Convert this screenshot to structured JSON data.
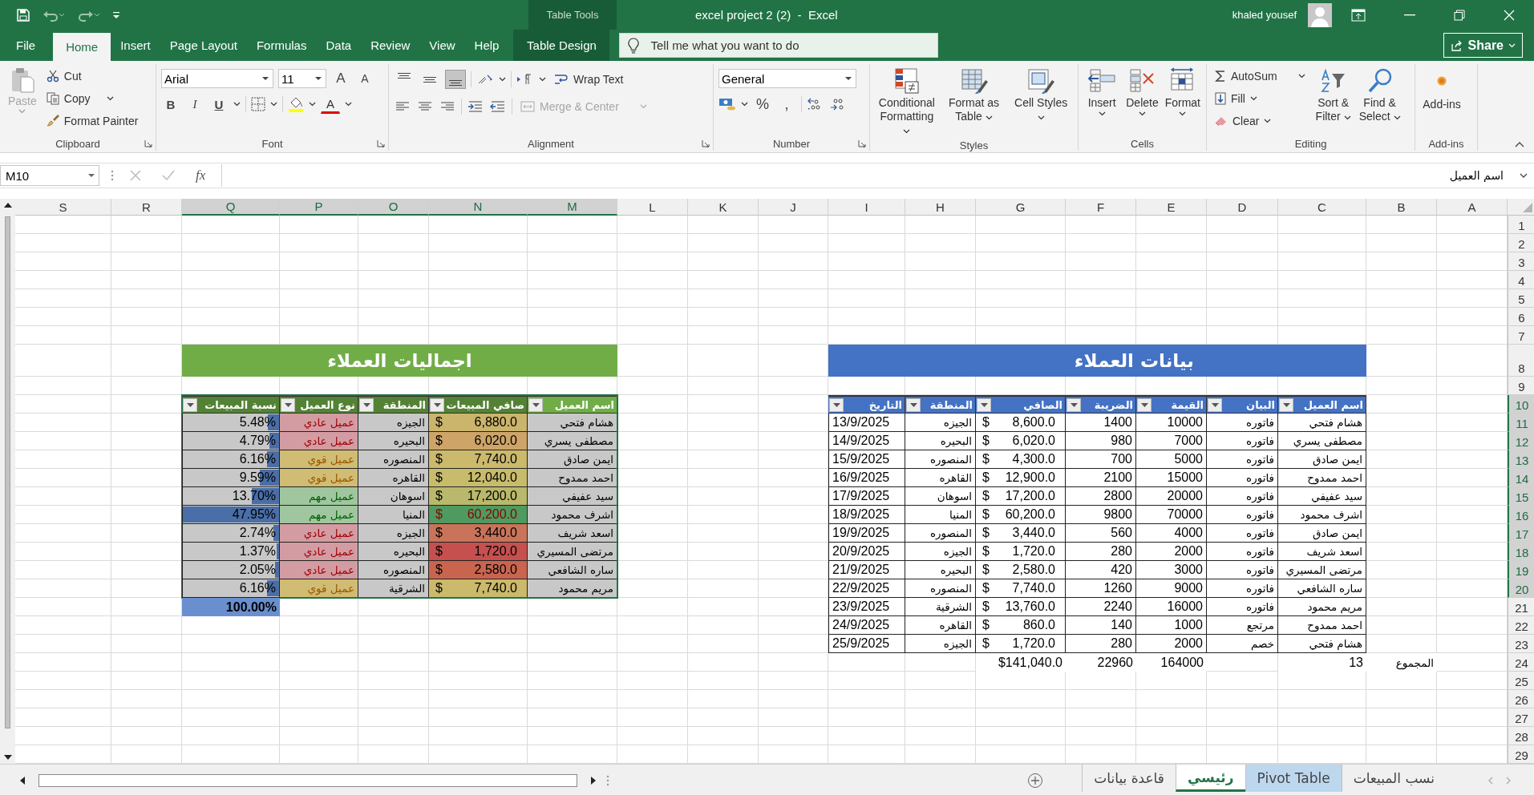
{
  "window": {
    "context_label": "Table Tools",
    "title": "excel project 2 (2)  -  Excel",
    "user": "khaled yousef"
  },
  "tabs": [
    {
      "label": "Table Design",
      "selected": false,
      "kind": "contextual"
    },
    {
      "label": "Help",
      "selected": false,
      "kind": "standard"
    },
    {
      "label": "View",
      "selected": false,
      "kind": "standard"
    },
    {
      "label": "Review",
      "selected": false,
      "kind": "standard"
    },
    {
      "label": "Data",
      "selected": false,
      "kind": "standard"
    },
    {
      "label": "Formulas",
      "selected": false,
      "kind": "standard"
    },
    {
      "label": "Page Layout",
      "selected": false,
      "kind": "standard"
    },
    {
      "label": "Insert",
      "selected": false,
      "kind": "standard"
    },
    {
      "label": "Home",
      "selected": true,
      "kind": "standard"
    },
    {
      "label": "File",
      "selected": false,
      "kind": "standard"
    }
  ],
  "tell_me": {
    "placeholder": "Tell me what you want to do"
  },
  "share": {
    "label": "Share"
  },
  "ribbon": {
    "clipboard": {
      "label": "Clipboard",
      "paste": {
        "label": "Paste",
        "disabled": true
      },
      "cut": "Cut",
      "copy": "Copy",
      "format_painter": "Format Painter"
    },
    "font": {
      "label": "Font",
      "name": "Arial",
      "size": "11",
      "grow": "A",
      "shrink": "A",
      "bold": "B",
      "italic": "I",
      "underline": "U",
      "color_letter": "A"
    },
    "alignment": {
      "label": "Alignment",
      "vertical": [
        {
          "selected": false
        },
        {
          "selected": false
        },
        {
          "selected": true
        }
      ],
      "wrap_text": "Wrap Text",
      "merge": {
        "label": "Merge & Center",
        "disabled": true
      }
    },
    "number": {
      "label": "Number",
      "format": "General",
      "percent": "%",
      "comma": ","
    },
    "styles": {
      "label": "Styles",
      "buttons": [
        "Cell Styles",
        "Format as Table",
        "Conditional Formatting"
      ]
    },
    "cells": {
      "label": "Cells",
      "buttons": [
        "Format",
        "Delete",
        "Insert"
      ]
    },
    "editing": {
      "label": "Editing",
      "autosum": "AutoSum",
      "fill": "Fill",
      "clear": "Clear",
      "sort": "Sort & Filter",
      "find": "Find & Select"
    },
    "addins": {
      "label": "Add-ins",
      "button": "Add-ins"
    }
  },
  "formula_bar": {
    "name_box": "M10",
    "fx": "fx",
    "value": "اسم العميل"
  },
  "sheet": {
    "column_headers": [
      {
        "label": "A",
        "selected": false
      },
      {
        "label": "B",
        "selected": false
      },
      {
        "label": "C",
        "selected": false
      },
      {
        "label": "D",
        "selected": false
      },
      {
        "label": "E",
        "selected": false
      },
      {
        "label": "F",
        "selected": false
      },
      {
        "label": "G",
        "selected": false
      },
      {
        "label": "H",
        "selected": false
      },
      {
        "label": "I",
        "selected": false
      },
      {
        "label": "J",
        "selected": false
      },
      {
        "label": "K",
        "selected": false
      },
      {
        "label": "L",
        "selected": false
      },
      {
        "label": "M",
        "selected": true
      },
      {
        "label": "N",
        "selected": true
      },
      {
        "label": "O",
        "selected": true
      },
      {
        "label": "P",
        "selected": true
      },
      {
        "label": "Q",
        "selected": true
      },
      {
        "label": "R",
        "selected": false
      },
      {
        "label": "S",
        "selected": false
      }
    ],
    "row_headers": [
      {
        "label": "1",
        "selected": false
      },
      {
        "label": "2",
        "selected": false
      },
      {
        "label": "3",
        "selected": false
      },
      {
        "label": "4",
        "selected": false
      },
      {
        "label": "5",
        "selected": false
      },
      {
        "label": "6",
        "selected": false
      },
      {
        "label": "7",
        "selected": false
      },
      {
        "label": "8",
        "selected": false
      },
      {
        "label": "9",
        "selected": false
      },
      {
        "label": "10",
        "selected": true
      },
      {
        "label": "11",
        "selected": true
      },
      {
        "label": "12",
        "selected": true
      },
      {
        "label": "13",
        "selected": true
      },
      {
        "label": "14",
        "selected": true
      },
      {
        "label": "15",
        "selected": true
      },
      {
        "label": "16",
        "selected": true
      },
      {
        "label": "17",
        "selected": true
      },
      {
        "label": "18",
        "selected": true
      },
      {
        "label": "19",
        "selected": true
      },
      {
        "label": "20",
        "selected": true
      },
      {
        "label": "21",
        "selected": false
      },
      {
        "label": "22",
        "selected": false
      },
      {
        "label": "23",
        "selected": false
      },
      {
        "label": "24",
        "selected": false
      },
      {
        "label": "25",
        "selected": false
      },
      {
        "label": "26",
        "selected": false
      },
      {
        "label": "27",
        "selected": false
      },
      {
        "label": "28",
        "selected": false
      },
      {
        "label": "29",
        "selected": false
      }
    ]
  },
  "summary_table": {
    "title": "اجماليات العملاء",
    "selected": true,
    "columns": [
      "اسم العميل",
      "صافي المبيعات",
      "المنطقة",
      "نوع العميل",
      "نسبة المبيعات"
    ],
    "rows": [
      {
        "name": "هشام فتحي",
        "currency": "$",
        "net": "6,880.0",
        "color": "#cbb46b",
        "alert": false,
        "region": "الجيزه",
        "type": "عميل عادي",
        "kind": "regular",
        "share": "5.48%",
        "level": 0.114
      },
      {
        "name": "مصطفى يسري",
        "currency": "$",
        "net": "6,020.0",
        "color": "#cea468",
        "alert": false,
        "region": "البحيره",
        "type": "عميل عادي",
        "kind": "regular",
        "share": "4.79%",
        "level": 0.1
      },
      {
        "name": "ايمن صادق",
        "currency": "$",
        "net": "7,740.0",
        "color": "#cbb96c",
        "alert": false,
        "region": "المنصوره",
        "type": "عميل قوي",
        "kind": "strong",
        "share": "6.16%",
        "level": 0.128
      },
      {
        "name": "احمد ممدوح",
        "currency": "$",
        "net": "12,040.0",
        "color": "#c8bc6c",
        "alert": false,
        "region": "القاهره",
        "type": "عميل قوي",
        "kind": "strong",
        "share": "9.59%",
        "level": 0.2
      },
      {
        "name": "سيد عفيفي",
        "currency": "$",
        "net": "17,200.0",
        "color": "#b9b86c",
        "alert": false,
        "region": "اسوهان",
        "type": "عميل مهم",
        "kind": "important",
        "share": "13.70%",
        "level": 0.286
      },
      {
        "name": "اشرف محمود",
        "currency": "$",
        "net": "60,200.0",
        "color": "#4f9a60",
        "alert": true,
        "region": "المنيا",
        "type": "عميل مهم",
        "kind": "important",
        "share": "47.95%",
        "level": 1
      },
      {
        "name": "اسعد شريف",
        "currency": "$",
        "net": "3,440.0",
        "color": "#c9745a",
        "alert": false,
        "region": "الجيزه",
        "type": "عميل عادي",
        "kind": "regular",
        "share": "2.74%",
        "level": 0.057
      },
      {
        "name": "مرتضى المسيري",
        "currency": "$",
        "net": "1,720.0",
        "color": "#c5504e",
        "alert": false,
        "region": "البحيره",
        "type": "عميل عادي",
        "kind": "regular",
        "share": "1.37%",
        "level": 0.029
      },
      {
        "name": "ساره الشافعي",
        "currency": "$",
        "net": "2,580.0",
        "color": "#c9654f",
        "alert": false,
        "region": "المنصوره",
        "type": "عميل عادي",
        "kind": "regular",
        "share": "2.05%",
        "level": 0.043
      },
      {
        "name": "مريم محمود",
        "currency": "$",
        "net": "7,740.0",
        "color": "#cbb96c",
        "alert": false,
        "region": "الشرقية",
        "type": "عميل قوي",
        "kind": "strong",
        "share": "6.16%",
        "level": 0.128
      }
    ],
    "total": "100.00%"
  },
  "data_table": {
    "title": "بيانات العملاء",
    "columns": [
      "اسم العميل",
      "البيان",
      "القيمة",
      "الضريبة",
      "الصافي",
      "المنطقة",
      "التاريخ"
    ],
    "rows": [
      {
        "name": "هشام فتحي",
        "statement": "فاتوره",
        "value": "10000",
        "tax": "1400",
        "currency": "$",
        "net": "8,600.0",
        "region": "الجيزه",
        "date": "13/9/2025"
      },
      {
        "name": "مصطفى يسري",
        "statement": "فاتوره",
        "value": "7000",
        "tax": "980",
        "currency": "$",
        "net": "6,020.0",
        "region": "البحيره",
        "date": "14/9/2025"
      },
      {
        "name": "ايمن صادق",
        "statement": "فاتوره",
        "value": "5000",
        "tax": "700",
        "currency": "$",
        "net": "4,300.0",
        "region": "المنصوره",
        "date": "15/9/2025"
      },
      {
        "name": "احمد ممدوح",
        "statement": "فاتوره",
        "value": "15000",
        "tax": "2100",
        "currency": "$",
        "net": "12,900.0",
        "region": "القاهره",
        "date": "16/9/2025"
      },
      {
        "name": "سيد عفيفي",
        "statement": "فاتوره",
        "value": "20000",
        "tax": "2800",
        "currency": "$",
        "net": "17,200.0",
        "region": "اسوهان",
        "date": "17/9/2025"
      },
      {
        "name": "اشرف محمود",
        "statement": "فاتوره",
        "value": "70000",
        "tax": "9800",
        "currency": "$",
        "net": "60,200.0",
        "region": "المنيا",
        "date": "18/9/2025"
      },
      {
        "name": "ايمن صادق",
        "statement": "فاتوره",
        "value": "4000",
        "tax": "560",
        "currency": "$",
        "net": "3,440.0",
        "region": "المنصوره",
        "date": "19/9/2025"
      },
      {
        "name": "اسعد شريف",
        "statement": "فاتوره",
        "value": "2000",
        "tax": "280",
        "currency": "$",
        "net": "1,720.0",
        "region": "الجيزه",
        "date": "20/9/2025"
      },
      {
        "name": "مرتضى المسيري",
        "statement": "فاتوره",
        "value": "3000",
        "tax": "420",
        "currency": "$",
        "net": "2,580.0",
        "region": "البحيره",
        "date": "21/9/2025"
      },
      {
        "name": "ساره الشافعي",
        "statement": "فاتوره",
        "value": "9000",
        "tax": "1260",
        "currency": "$",
        "net": "7,740.0",
        "region": "المنصوره",
        "date": "22/9/2025"
      },
      {
        "name": "مريم محمود",
        "statement": "فاتوره",
        "value": "16000",
        "tax": "2240",
        "currency": "$",
        "net": "13,760.0",
        "region": "الشرقية",
        "date": "23/9/2025"
      },
      {
        "name": "احمد ممدوح",
        "statement": "مرتجع",
        "value": "1000",
        "tax": "140",
        "currency": "$",
        "net": "860.0",
        "region": "القاهره",
        "date": "24/9/2025"
      },
      {
        "name": "هشام فتحي",
        "statement": "خصم",
        "value": "2000",
        "tax": "280",
        "currency": "$",
        "net": "1,720.0",
        "region": "الجيزه",
        "date": "25/9/2025"
      }
    ],
    "totals": {
      "name": "13",
      "value": "164000",
      "tax": "22960",
      "net": "$141,040.0"
    },
    "totals_label": "المجموع"
  },
  "sheet_tabs": [
    {
      "label": "نسب المبيعات",
      "selected": false
    },
    {
      "label": "Pivot Table",
      "selected": false,
      "color": "#bdd7ee"
    },
    {
      "label": "رئيسي",
      "selected": true
    },
    {
      "label": "قاعدة بيانات",
      "selected": false
    }
  ]
}
